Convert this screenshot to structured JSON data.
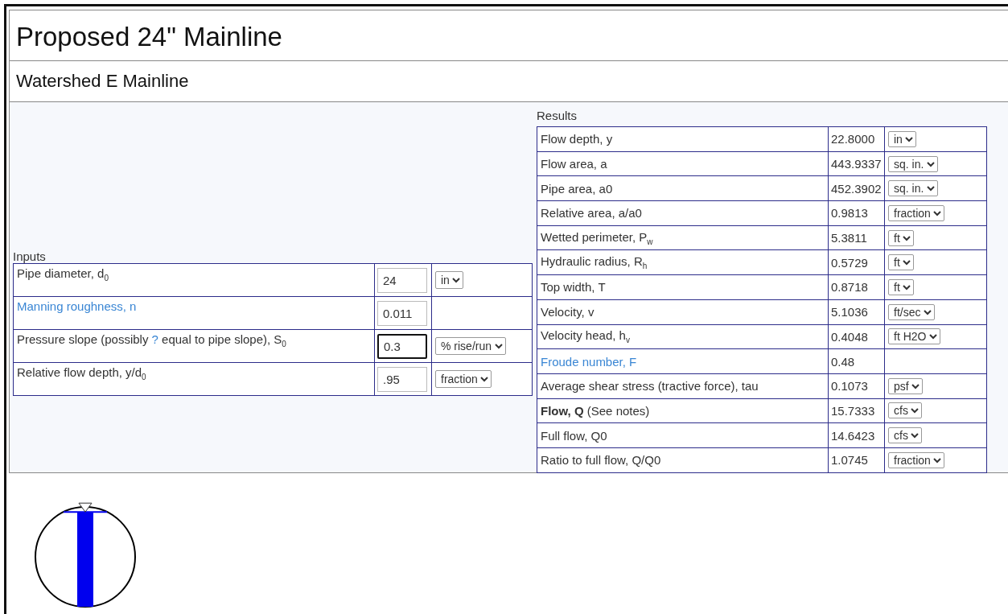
{
  "title": "Proposed 24\" Mainline",
  "subtitle": "Watershed E Mainline",
  "inputs": {
    "heading": "Inputs",
    "rows": [
      {
        "label_parts": [
          {
            "text": "Pipe diameter, d$_{0}$",
            "link": false
          }
        ],
        "value": "24",
        "focused": false,
        "unit": "in"
      },
      {
        "label_parts": [
          {
            "text": "Manning roughness, n",
            "link": true
          }
        ],
        "value": "0.011",
        "focused": false
      },
      {
        "label_parts": [
          {
            "text": "Pressure slope (possibly ",
            "link": false
          },
          {
            "text": "?",
            "link": true
          },
          {
            "text": " equal to pipe slope), S$_{0}$",
            "link": false
          }
        ],
        "value": "0.3",
        "focused": true,
        "unit": "% rise/run"
      },
      {
        "label_parts": [
          {
            "text": "Relative flow depth, y/d$_{0}$",
            "link": false
          }
        ],
        "value": ".95",
        "focused": false,
        "unit": "fraction"
      }
    ]
  },
  "results": {
    "heading": "Results",
    "rows": [
      {
        "label_parts": [
          {
            "text": "Flow depth, y",
            "link": false
          }
        ],
        "value": "22.8000",
        "unit": "in"
      },
      {
        "label_parts": [
          {
            "text": "Flow area, a",
            "link": false
          }
        ],
        "value": "443.9337",
        "unit": "sq. in."
      },
      {
        "label_parts": [
          {
            "text": "Pipe area, a0",
            "link": false
          }
        ],
        "value": "452.3902",
        "unit": "sq. in."
      },
      {
        "label_parts": [
          {
            "text": "Relative area, a/a0",
            "link": false
          }
        ],
        "value": "0.9813",
        "unit": "fraction"
      },
      {
        "label_parts": [
          {
            "text": "Wetted perimeter, P$_{w}$",
            "link": false
          }
        ],
        "value": "5.3811",
        "unit": "ft"
      },
      {
        "label_parts": [
          {
            "text": "Hydraulic radius, R$_{h}$",
            "link": false
          }
        ],
        "value": "0.5729",
        "unit": "ft"
      },
      {
        "label_parts": [
          {
            "text": "Top width, T",
            "link": false
          }
        ],
        "value": "0.8718",
        "unit": "ft"
      },
      {
        "label_parts": [
          {
            "text": "Velocity, v",
            "link": false
          }
        ],
        "value": "5.1036",
        "unit": "ft/sec"
      },
      {
        "label_parts": [
          {
            "text": "Velocity head, h$_{v}$",
            "link": false
          }
        ],
        "value": "0.4048",
        "unit": "ft H2O"
      },
      {
        "label_parts": [
          {
            "text": "Froude number, F",
            "link": true
          }
        ],
        "value": "0.48"
      },
      {
        "label_parts": [
          {
            "text": "Average shear stress (tractive force), tau",
            "link": false
          }
        ],
        "value": "0.1073",
        "unit": "psf"
      },
      {
        "label_parts": [
          {
            "text": "**Flow, Q** (See notes)",
            "link": false
          }
        ],
        "value": "15.7333",
        "unit": "cfs"
      },
      {
        "label_parts": [
          {
            "text": "Full flow, Q0",
            "link": false
          }
        ],
        "value": "14.6423",
        "unit": "cfs"
      },
      {
        "label_parts": [
          {
            "text": "Ratio to full flow, Q/Q0",
            "link": false
          }
        ],
        "value": "1.0745",
        "unit": "fraction"
      }
    ]
  },
  "diagram": {
    "level": 0.95
  }
}
